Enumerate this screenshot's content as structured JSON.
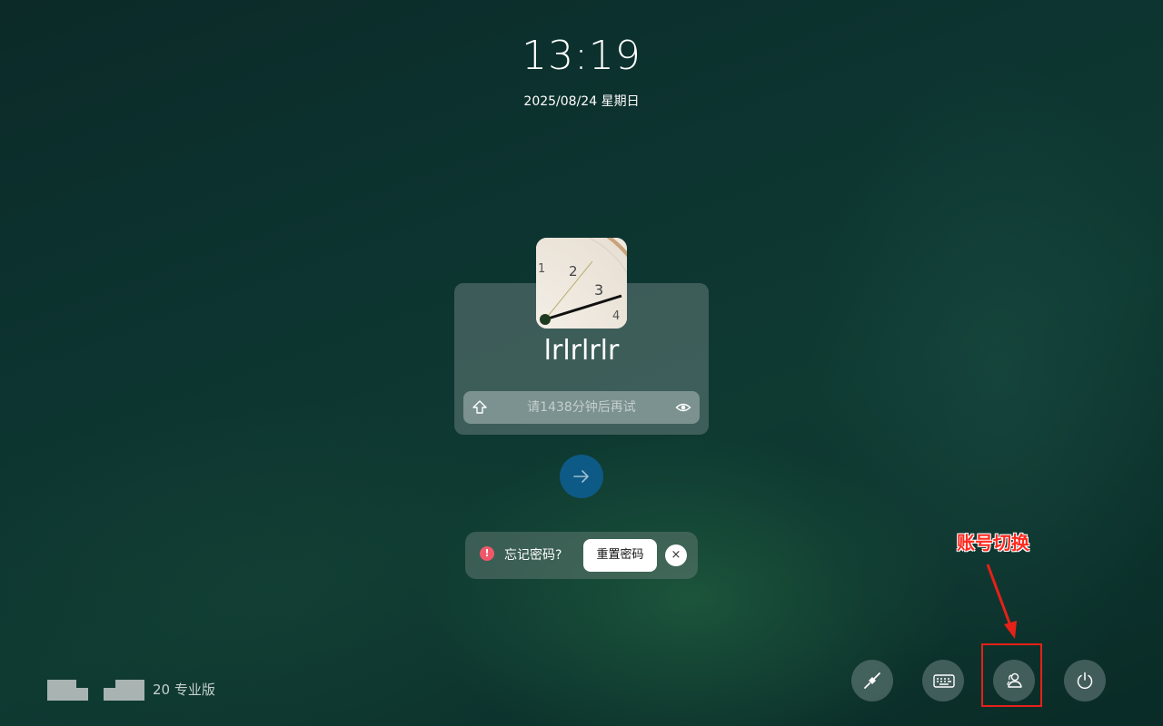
{
  "clock": {
    "time": "13:19",
    "date": "2025/08/24 星期日"
  },
  "user": {
    "name": "lrlrlrlr"
  },
  "password_field": {
    "placeholder": "请1438分钟后再试"
  },
  "notice": {
    "text": "忘记密码?",
    "reset_label": "重置密码",
    "close_glyph": "×",
    "alert_glyph": "!"
  },
  "annotation": {
    "label": "账号切换",
    "color": "#e52118"
  },
  "footer": {
    "edition": "20 专业版"
  },
  "colors": {
    "submit_button": "#0e5a86",
    "alert": "#f0586a"
  },
  "icons": {
    "caps_lock": "capslock-icon",
    "show_password": "eye-icon",
    "submit": "arrow-right-icon",
    "network": "plug-icon",
    "keyboard": "keyboard-icon",
    "switch_user": "users-icon",
    "power": "power-icon"
  }
}
